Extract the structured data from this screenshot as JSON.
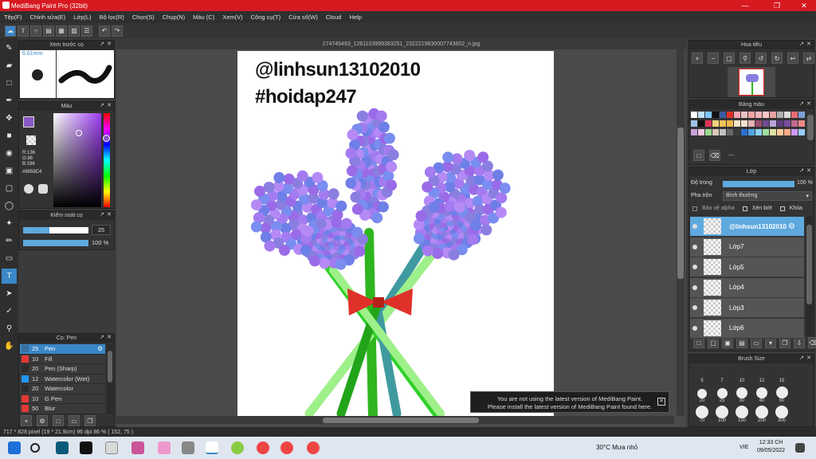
{
  "window": {
    "title": "MediBang Paint Pro (32bit)"
  },
  "menu": [
    "Tệp(F)",
    "Chỉnh sửa(E)",
    "Lớp(L)",
    "Bộ lọc(R)",
    "Chọn(S)",
    "Chụp(N)",
    "Màu (C)",
    "Xem(V)",
    "Công cụ(T)",
    "Cửa sổ(W)",
    "Cloud",
    "Help"
  ],
  "document": {
    "filename": "274745493_1261103999383251_2322219830007743602_n.jpg"
  },
  "canvas": {
    "line1": "@linhsun13102010",
    "line2": "#hoidap247"
  },
  "brush_preview": {
    "title": "Xem trước cọ",
    "size": "6.61mm"
  },
  "color_panel": {
    "title": "Màu",
    "r": "R:136",
    "g": "G:88",
    "b": "B:196",
    "hex": "#8858C4",
    "current": "#8858C4"
  },
  "brush_control": {
    "title": "Kiểm soát cọ",
    "size_value": "25",
    "opacity_value": "100 %",
    "size_fraction": 0.4,
    "opacity_fraction": 1.0
  },
  "brush_list": {
    "title": "Cọ: Pen",
    "items": [
      {
        "size": "25",
        "name": "Pen",
        "color": "#3a6fa0",
        "selected": true
      },
      {
        "size": "10",
        "name": "Fill",
        "color": "#e53935",
        "selected": false
      },
      {
        "size": "20",
        "name": "Pen (Sharp)",
        "color": "#2b2b2b",
        "selected": false
      },
      {
        "size": "12",
        "name": "Watercolor (Wet)",
        "color": "#2196f3",
        "selected": false
      },
      {
        "size": "20",
        "name": "Watercolor",
        "color": "#2b2b2b",
        "selected": false
      },
      {
        "size": "10",
        "name": "G Pen",
        "color": "#e53935",
        "selected": false
      },
      {
        "size": "50",
        "name": "Blur",
        "color": "#e53935",
        "selected": false
      }
    ]
  },
  "navigator": {
    "title": "Hoa tiêu"
  },
  "palette": {
    "title": "Bảng màu",
    "extra": "---"
  },
  "layers": {
    "title": "Lớp",
    "opacity_label": "Độ trong",
    "opacity_value": "100 %",
    "blend_label": "Pha trộn",
    "blend_value": "Bình thường",
    "alpha_lock": "Bảo vệ alpha",
    "clipping": "Xén bớt",
    "lock": "Khóa",
    "items": [
      {
        "name": "@linhsun13102010",
        "selected": true
      },
      {
        "name": "Lớp7",
        "selected": false
      },
      {
        "name": "Lớp5",
        "selected": false
      },
      {
        "name": "Lớp4",
        "selected": false
      },
      {
        "name": "Lớp3",
        "selected": false
      },
      {
        "name": "Lớp6",
        "selected": false
      }
    ]
  },
  "brush_size": {
    "title": "Brush Size",
    "row0": [
      "5",
      "7",
      "10",
      "12",
      "15"
    ],
    "row1": [
      "20",
      "25",
      "30",
      "40",
      "50"
    ],
    "row2": [
      "70",
      "100",
      "150",
      "200",
      "300"
    ]
  },
  "notice": {
    "line1": "You are not using the latest version of MediBang Paint.",
    "line2": "Please install the latest version of MediBang Paint found here."
  },
  "status": {
    "text": "717 * 828 pixel   (19 * 21.9cm)   96 dpi   86 %   ( 152, 75 )"
  },
  "taskbar": {
    "weather": "30°C  Mưa nhỏ",
    "lang": "VIE",
    "time": "12:33 CH",
    "date": "09/05/2022"
  }
}
